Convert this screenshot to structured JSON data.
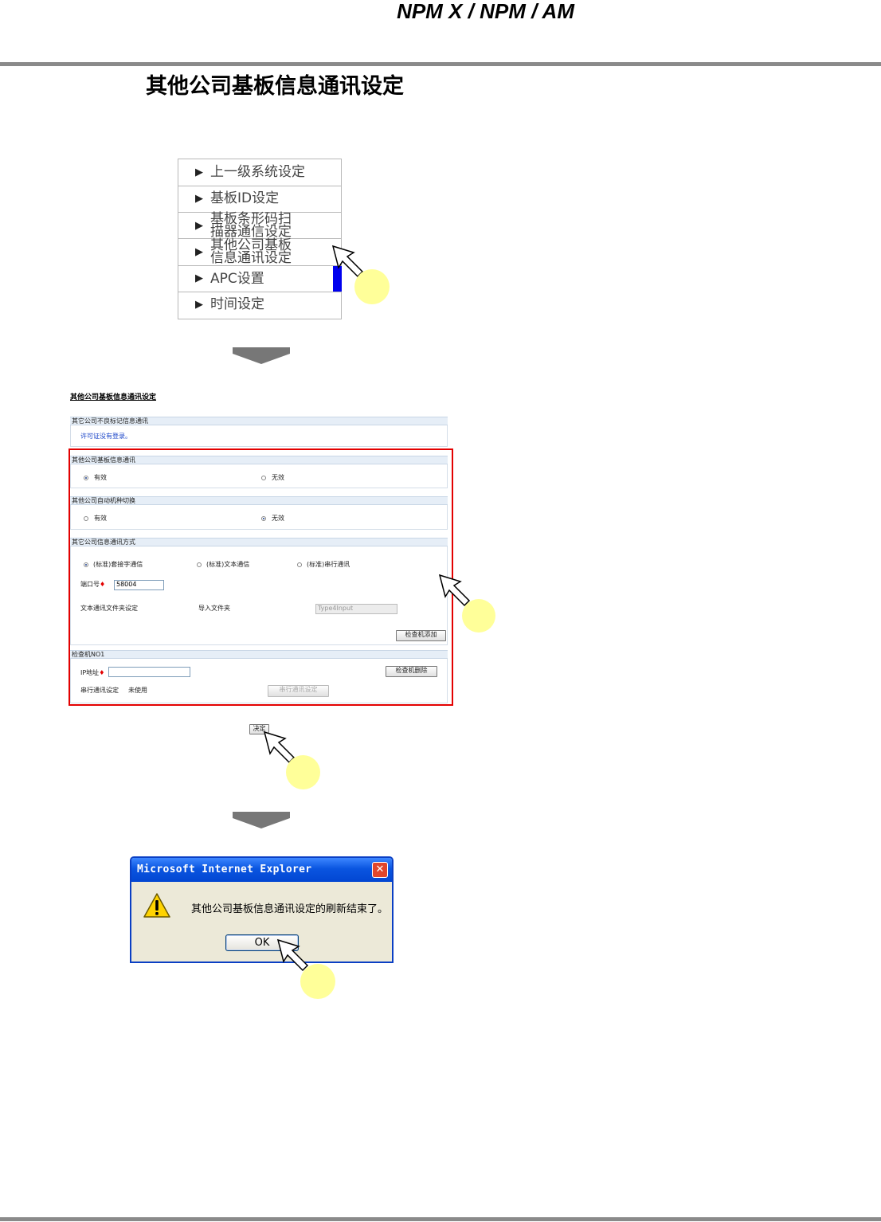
{
  "header": {
    "product": "NPM X / NPM / AM"
  },
  "page_title": "其他公司基板信息通讯设定",
  "menu": {
    "items": [
      {
        "line1": "上一级系统设定",
        "line2": ""
      },
      {
        "line1": "基板ID设定",
        "line2": ""
      },
      {
        "line1": "基板条形码扫",
        "line2": "描器通信设定"
      },
      {
        "line1": "其他公司基板",
        "line2": "信息通讯设定"
      },
      {
        "line1": "APC设置",
        "line2": ""
      },
      {
        "line1": "时间设定",
        "line2": ""
      }
    ]
  },
  "form": {
    "title": "其他公司基板信息通讯设定",
    "defect_section": {
      "header": "其它公司不良标记信息通讯",
      "notice": "许可证没有登录。"
    },
    "board_info_section": {
      "header": "其他公司基板信息通讯",
      "opt_valid": "有效",
      "opt_invalid": "无效",
      "selected": "有效"
    },
    "auto_switch_section": {
      "header": "其他公司自动机种切换",
      "opt_valid": "有效",
      "opt_invalid": "无效",
      "selected": "无效"
    },
    "method_section": {
      "header": "其它公司信息通讯方式",
      "opt1": "(标准)套接字通信",
      "opt2": "(标准)文本通信",
      "opt3": "(标准)串行通讯",
      "selected": "(标准)套接字通信",
      "port_label": "端口号",
      "port_value": "58004",
      "text_folder_label": "文本通讯文件夹设定",
      "import_folder_label": "导入文件夹",
      "import_folder_value": "Type4Input",
      "add_checker_button": "检查机添加"
    },
    "checker_section": {
      "header": "检查机NO1",
      "ip_label": "IP地址",
      "ip_value": "",
      "delete_button": "检查机删除",
      "serial_label": "串行通讯设定",
      "serial_value": "未使用",
      "serial_button": "串行通讯设定"
    },
    "confirm_button": "决定"
  },
  "dialog": {
    "title": "Microsoft Internet Explorer",
    "message": "其他公司基板信息通讯设定的刷新结束了。",
    "ok_label": "OK",
    "close_glyph": "✕"
  },
  "colors": {
    "highlight_frame": "#e30000",
    "menu_active": "#0000ee",
    "marker": "#ffff99",
    "dialog_titlebar": "#0a55e0"
  }
}
